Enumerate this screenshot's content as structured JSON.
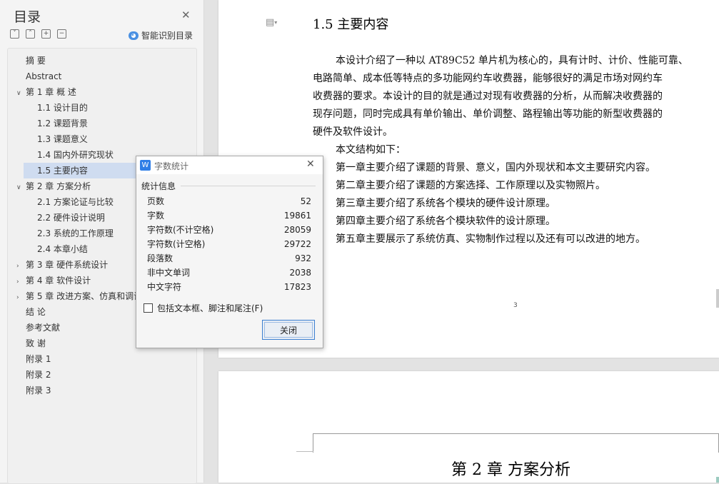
{
  "toc": {
    "title": "目录",
    "smart_toc_label": "智能识别目录",
    "tool_icons": [
      "expand-all-icon",
      "collapse-all-icon",
      "add-icon",
      "remove-icon"
    ],
    "items": [
      {
        "label": "摘  要",
        "level": 0,
        "arrow": ""
      },
      {
        "label": "Abstract",
        "level": 0,
        "arrow": ""
      },
      {
        "label": "第 1 章  概  述",
        "level": 0,
        "arrow": "open"
      },
      {
        "label": "1.1  设计目的",
        "level": 1,
        "arrow": ""
      },
      {
        "label": "1.2  课题背景",
        "level": 1,
        "arrow": ""
      },
      {
        "label": "1.3  课题意义",
        "level": 1,
        "arrow": ""
      },
      {
        "label": "1.4  国内外研究现状",
        "level": 1,
        "arrow": ""
      },
      {
        "label": "1.5  主要内容",
        "level": 1,
        "arrow": "",
        "selected": true
      },
      {
        "label": "第 2 章  方案分析",
        "level": 0,
        "arrow": "open"
      },
      {
        "label": "2.1  方案论证与比较",
        "level": 1,
        "arrow": ""
      },
      {
        "label": "2.2  硬件设计说明",
        "level": 1,
        "arrow": ""
      },
      {
        "label": "2.3  系统的工作原理",
        "level": 1,
        "arrow": ""
      },
      {
        "label": "2.4  本章小结",
        "level": 1,
        "arrow": ""
      },
      {
        "label": "第 3 章  硬件系统设计",
        "level": 0,
        "arrow": "closed"
      },
      {
        "label": "第 4 章  软件设计",
        "level": 0,
        "arrow": "closed"
      },
      {
        "label": "第 5 章  改进方案、仿真和调试",
        "level": 0,
        "arrow": "closed"
      },
      {
        "label": "结  论",
        "level": 0,
        "arrow": ""
      },
      {
        "label": "参考文献",
        "level": 0,
        "arrow": ""
      },
      {
        "label": "致  谢",
        "level": 0,
        "arrow": ""
      },
      {
        "label": "附录 1",
        "level": 0,
        "arrow": ""
      },
      {
        "label": "附录 2",
        "level": 0,
        "arrow": ""
      },
      {
        "label": "附录 3",
        "level": 0,
        "arrow": ""
      }
    ]
  },
  "document": {
    "section_heading": "1.5  主要内容",
    "paragraph_lines": [
      "本设计介绍了一种以 AT89C52 单片机为核心的，具有计时、计价、性能可靠、",
      "电路简单、成本低等特点的多功能网约车收费器，能够很好的满足市场对网约车",
      "收费器的要求。本设计的目的就是通过对现有收费器的分析，从而解决收费器的",
      "现存问题，同时完成具有单价输出、单价调整、路程输出等功能的新型收费器的",
      "硬件及软件设计。"
    ],
    "structure_lines": [
      "本文结构如下：",
      "第一章主要介绍了课题的背景、意义，国内外现状和本文主要研究内容。",
      "第二章主要介绍了课题的方案选择、工作原理以及实物照片。",
      "第三章主要介绍了系统各个模块的硬件设计原理。",
      "第四章主要介绍了系统各个模块软件的设计原理。",
      "第五章主要展示了系统仿真、实物制作过程以及还有可以改进的地方。"
    ],
    "page_number": "3",
    "next_heading": "第 2 章  方案分析"
  },
  "dialog": {
    "title": "字数统计",
    "group_label": "统计信息",
    "stats": [
      {
        "label": "页数",
        "value": "52"
      },
      {
        "label": "字数",
        "value": "19861"
      },
      {
        "label": "字符数(不计空格)",
        "value": "28059"
      },
      {
        "label": "字符数(计空格)",
        "value": "29722"
      },
      {
        "label": "段落数",
        "value": "932"
      },
      {
        "label": "非中文单词",
        "value": "2038"
      },
      {
        "label": "中文字符",
        "value": "17823"
      }
    ],
    "checkbox_label": "包括文本框、脚注和尾注(F)",
    "checkbox_checked": false,
    "close_button": "关闭"
  },
  "colors": {
    "selected_item": "#cfdcf0",
    "accent": "#2f7ee6"
  }
}
